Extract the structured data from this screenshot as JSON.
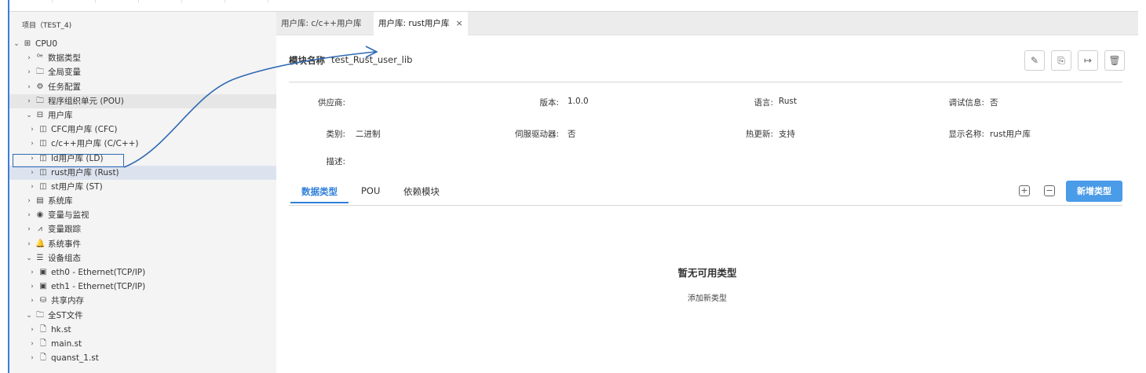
{
  "project": {
    "title": "项目（TEST_4)"
  },
  "tree": [
    {
      "indent": 0,
      "chev": "⌄",
      "icon": "⊞",
      "icon_name": "cpu-icon",
      "label": "CPU0",
      "state": ""
    },
    {
      "indent": 1,
      "chev": "›",
      "icon": "⁰ᵉ",
      "icon_name": "datatype-icon",
      "label": "数据类型",
      "state": ""
    },
    {
      "indent": 1,
      "chev": "›",
      "icon": "🗀",
      "icon_name": "folder-icon",
      "label": "全局变量",
      "state": ""
    },
    {
      "indent": 1,
      "chev": "›",
      "icon": "⚙",
      "icon_name": "gear-icon",
      "label": "任务配置",
      "state": ""
    },
    {
      "indent": 1,
      "chev": "›",
      "icon": "🗀",
      "icon_name": "folder-icon",
      "label": "程序组织单元 (POU)",
      "state": "hover"
    },
    {
      "indent": 1,
      "chev": "⌄",
      "icon": "⊟",
      "icon_name": "library-icon",
      "label": "用户库",
      "state": ""
    },
    {
      "indent": 2,
      "chev": "›",
      "icon": "◫",
      "icon_name": "book-icon",
      "label": "CFC用户库 (CFC)",
      "state": ""
    },
    {
      "indent": 2,
      "chev": "›",
      "icon": "◫",
      "icon_name": "book-icon",
      "label": "c/c++用户库 (C/C++)",
      "state": ""
    },
    {
      "indent": 2,
      "chev": "›",
      "icon": "◫",
      "icon_name": "book-icon",
      "label": "ld用户库 (LD)",
      "state": ""
    },
    {
      "indent": 2,
      "chev": "›",
      "icon": "◫",
      "icon_name": "book-icon",
      "label": "rust用户库 (Rust)",
      "state": "selected"
    },
    {
      "indent": 2,
      "chev": "›",
      "icon": "◫",
      "icon_name": "book-icon",
      "label": "st用户库 (ST)",
      "state": ""
    },
    {
      "indent": 1,
      "chev": "›",
      "icon": "▤",
      "icon_name": "system-library-icon",
      "label": "系统库",
      "state": ""
    },
    {
      "indent": 1,
      "chev": "›",
      "icon": "◉",
      "icon_name": "eye-icon",
      "label": "变量与监视",
      "state": ""
    },
    {
      "indent": 1,
      "chev": "›",
      "icon": "⩘",
      "icon_name": "trend-icon",
      "label": "变量跟踪",
      "state": ""
    },
    {
      "indent": 1,
      "chev": "›",
      "icon": "🔔",
      "icon_name": "bell-icon",
      "label": "系统事件",
      "state": ""
    },
    {
      "indent": 1,
      "chev": "⌄",
      "icon": "☰",
      "icon_name": "device-icon",
      "label": "设备组态",
      "state": ""
    },
    {
      "indent": 2,
      "chev": "›",
      "icon": "▣",
      "icon_name": "ethernet-icon",
      "label": "eth0 - Ethernet(TCP/IP)",
      "state": ""
    },
    {
      "indent": 2,
      "chev": "›",
      "icon": "▣",
      "icon_name": "ethernet-icon",
      "label": "eth1 - Ethernet(TCP/IP)",
      "state": ""
    },
    {
      "indent": 2,
      "chev": "›",
      "icon": "⛁",
      "icon_name": "database-icon",
      "label": "共享内存",
      "state": ""
    },
    {
      "indent": 1,
      "chev": "⌄",
      "icon": "🗀",
      "icon_name": "folder-icon",
      "label": "全ST文件",
      "state": ""
    },
    {
      "indent": 2,
      "chev": "›",
      "icon": "🗋",
      "icon_name": "file-icon",
      "label": "hk.st",
      "state": ""
    },
    {
      "indent": 2,
      "chev": "›",
      "icon": "🗋",
      "icon_name": "file-icon",
      "label": "main.st",
      "state": ""
    },
    {
      "indent": 2,
      "chev": "›",
      "icon": "🗋",
      "icon_name": "file-icon",
      "label": "quanst_1.st",
      "state": ""
    }
  ],
  "tabs": [
    {
      "label": "用户库: c/c++用户库",
      "active": false
    },
    {
      "label": "用户库: rust用户库",
      "active": true,
      "close": "×"
    }
  ],
  "module": {
    "name_label": "模块名称",
    "name_value": "test_Rust_user_lib",
    "toolbar": [
      {
        "name": "edit-icon",
        "glyph": "✎"
      },
      {
        "name": "file-export-icon",
        "glyph": "⎘"
      },
      {
        "name": "export-arrow-icon",
        "glyph": "↦"
      },
      {
        "name": "trash-icon",
        "glyph": "🗑"
      }
    ]
  },
  "info": {
    "vendor_label": "供应商:",
    "vendor_value": "",
    "version_label": "版本:",
    "version_value": "1.0.0",
    "language_label": "语言:",
    "language_value": "Rust",
    "debug_label": "调试信息:",
    "debug_value": "否",
    "category_label": "类别:",
    "category_value": "二进制",
    "servo_label": "伺服驱动器:",
    "servo_value": "否",
    "hotupdate_label": "热更新:",
    "hotupdate_value": "支持",
    "display_label": "显示名称:",
    "display_value": "rust用户库",
    "desc_label": "描述:",
    "desc_value": ""
  },
  "subtabs": [
    {
      "label": "数据类型",
      "active": true
    },
    {
      "label": "POU",
      "active": false
    },
    {
      "label": "依赖模块",
      "active": false
    }
  ],
  "actions": {
    "expand_glyph": "+",
    "collapse_glyph": "−",
    "add_type_label": "新增类型"
  },
  "empty": {
    "title": "暂无可用类型",
    "subtitle": "添加新类型"
  },
  "colors": {
    "accent": "#2f7fd8",
    "primary_button": "#4a9be8",
    "annotation": "#2f6ab3"
  }
}
